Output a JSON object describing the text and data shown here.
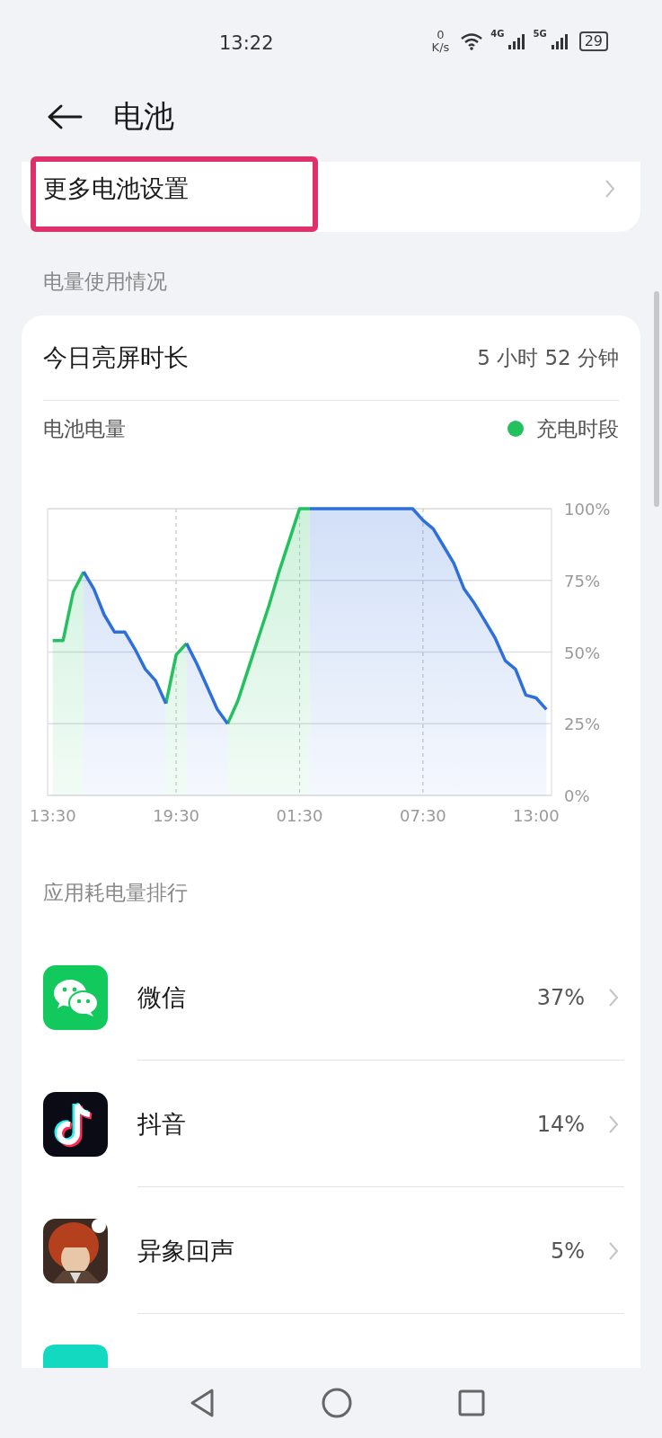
{
  "status_bar": {
    "time": "13:22",
    "net_speed": "0",
    "net_unit": "K/s",
    "signal_1": "4G",
    "signal_2": "5G",
    "battery": "29"
  },
  "header": {
    "title": "电池"
  },
  "settings_row": {
    "label": "更多电池设置",
    "highlighted": true
  },
  "usage_section": {
    "label": "电量使用情况"
  },
  "screen_time": {
    "label": "今日亮屏时长",
    "value": "5 小时 52 分钟"
  },
  "battery_chart": {
    "label": "电池电量",
    "chart_data": {
      "type": "area",
      "categories": [
        "13:30",
        null,
        null,
        null,
        null,
        null,
        null,
        null,
        null,
        null,
        null,
        null,
        "19:30",
        null,
        null,
        null,
        null,
        null,
        null,
        null,
        null,
        null,
        null,
        null,
        "01:30",
        null,
        null,
        null,
        null,
        null,
        null,
        null,
        null,
        null,
        null,
        null,
        "07:30",
        null,
        null,
        null,
        null,
        null,
        null,
        null,
        null,
        null,
        null,
        "13:00",
        null
      ],
      "series": [
        {
          "name": "充电时段",
          "color": "#22c15e",
          "values": [
            54,
            54,
            71,
            78,
            null,
            null,
            null,
            null,
            null,
            null,
            null,
            32,
            49,
            53,
            null,
            null,
            null,
            25,
            33,
            44,
            55,
            66,
            78,
            89,
            100,
            100,
            null,
            null,
            null,
            null,
            null,
            null,
            null,
            null,
            null,
            null,
            null,
            null,
            null,
            null,
            null,
            null,
            null,
            null,
            null,
            null,
            null,
            null,
            null
          ]
        },
        {
          "color": "#2f6fdc",
          "values": [
            null,
            null,
            null,
            78,
            72,
            63,
            57,
            57,
            51,
            44,
            40,
            32,
            null,
            53,
            46,
            38,
            30,
            25,
            null,
            null,
            null,
            null,
            null,
            null,
            null,
            100,
            100,
            100,
            100,
            100,
            100,
            100,
            100,
            100,
            100,
            100,
            96,
            93,
            87,
            81,
            72,
            67,
            61,
            55,
            47,
            44,
            35,
            34,
            30
          ]
        }
      ],
      "ylim": [
        0,
        100
      ],
      "grid": true,
      "yticks": [
        {
          "value": 0,
          "label": "0%"
        },
        {
          "value": 25,
          "label": "25%"
        },
        {
          "value": 50,
          "label": "50%"
        },
        {
          "value": 75,
          "label": "75%"
        },
        {
          "value": 100,
          "label": "100%"
        }
      ]
    }
  },
  "apps_section": {
    "label": "应用耗电量排行"
  },
  "apps": [
    {
      "kind": "chat",
      "name": "微信",
      "percent": "37%"
    },
    {
      "kind": "note",
      "name": "抖音",
      "percent": "14%"
    },
    {
      "kind": "picture",
      "name": "异象回声",
      "percent": "5%"
    },
    {
      "kind": "partial"
    }
  ]
}
